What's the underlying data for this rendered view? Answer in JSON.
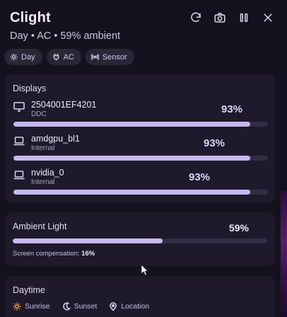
{
  "app": {
    "title": "Clight",
    "subtitle": "Day • AC • 59% ambient"
  },
  "header_actions": [
    "refresh-icon",
    "camera-icon",
    "pause-icon",
    "close-icon"
  ],
  "chips": [
    {
      "label": "Day",
      "icon": "sun-icon"
    },
    {
      "label": "AC",
      "icon": "plug-icon"
    },
    {
      "label": "Sensor",
      "icon": "sensor-icon"
    }
  ],
  "displays": {
    "title": "Displays",
    "items": [
      {
        "name": "2504001EF4201",
        "type": "DDC",
        "percent_label": "93%",
        "level": 0.93,
        "icon": "monitor-icon"
      },
      {
        "name": "amdgpu_bl1",
        "type": "Internal",
        "percent_label": "93%",
        "level": 0.93,
        "icon": "laptop-icon"
      },
      {
        "name": "nvidia_0",
        "type": "Internal",
        "percent_label": "93%",
        "level": 0.93,
        "icon": "laptop-icon"
      }
    ]
  },
  "ambient": {
    "title": "Ambient Light",
    "percent_label": "59%",
    "level": 0.59,
    "compensation_label": "Screen compensation:",
    "compensation_value": "16%"
  },
  "daytime": {
    "title": "Daytime",
    "items": [
      {
        "label": "Sunrise",
        "icon": "sunrise-icon"
      },
      {
        "label": "Sunset",
        "icon": "moon-icon"
      },
      {
        "label": "Location",
        "icon": "location-icon"
      }
    ]
  },
  "colors": {
    "accent": "#c8b8f2",
    "sunrise": "#f0a030",
    "card": "#1e1a2c"
  }
}
